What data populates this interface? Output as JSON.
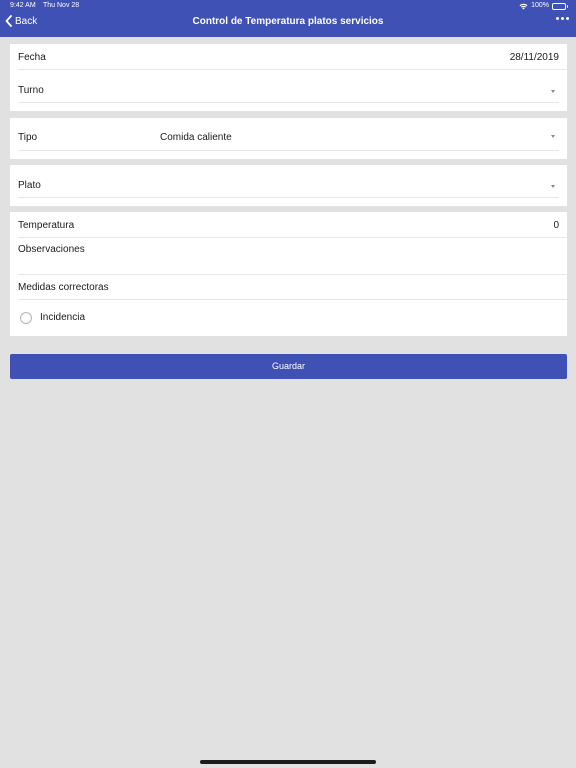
{
  "status_bar": {
    "time": "9:42 AM",
    "date": "Thu Nov 28",
    "battery": "100%",
    "icons": [
      "wifi-icon",
      "battery-icon"
    ]
  },
  "navbar": {
    "back_label": "Back",
    "title": "Control de Temperatura platos servicios",
    "more_icon": "more-icon",
    "color": "#3f51b5"
  },
  "form": {
    "fecha": {
      "label": "Fecha",
      "value": "28/11/2019"
    },
    "turno": {
      "label": "Turno",
      "value": ""
    },
    "tipo": {
      "label": "Tipo",
      "value": "Comida caliente"
    },
    "plato": {
      "label": "Plato",
      "value": ""
    },
    "temperatura": {
      "label": "Temperatura",
      "value": "0"
    },
    "observaciones": {
      "label": "Observaciones",
      "value": ""
    },
    "medidas": {
      "label": "Medidas correctoras",
      "value": ""
    },
    "incidencia": {
      "label": "Incidencia",
      "checked": false
    }
  },
  "actions": {
    "save_label": "Guardar"
  }
}
